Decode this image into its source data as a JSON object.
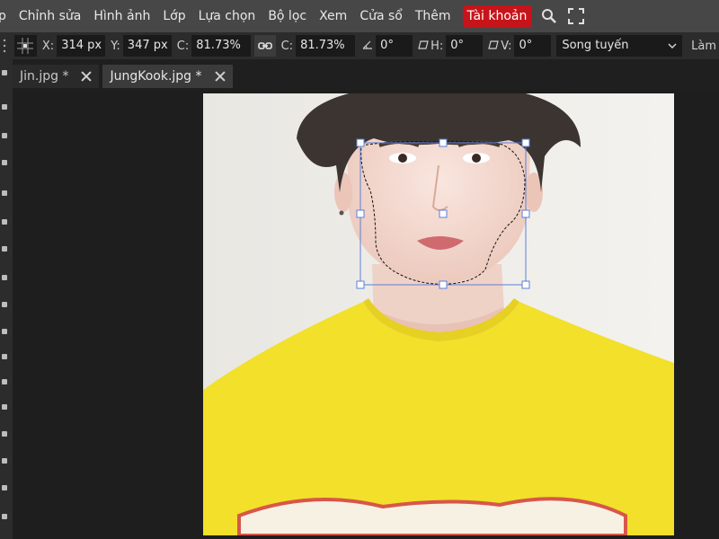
{
  "menu": {
    "items": [
      "p",
      "Chỉnh sửa",
      "Hình ảnh",
      "Lớp",
      "Lựa chọn",
      "Bộ lọc",
      "Xem",
      "Cửa sổ",
      "Thêm"
    ],
    "account_label": "Tài khoản",
    "icons": [
      "search-icon",
      "fullscreen-icon"
    ]
  },
  "options": {
    "x_label": "X:",
    "x_value": "314 px",
    "y_label": "Y:",
    "y_value": "347 px",
    "w_label": "C:",
    "w_value": "81.73%",
    "h_label": "C:",
    "h_value": "81.73%",
    "rotate_value": "0°",
    "skew_h_label": "H:",
    "skew_h_value": "0°",
    "skew_v_label": "V:",
    "skew_v_value": "0°",
    "interpolation": "Song tuyến",
    "overflow_label": "Làm"
  },
  "tabs": [
    {
      "label": "Jin.jpg *",
      "active": false
    },
    {
      "label": "JungKook.jpg *",
      "active": true
    }
  ],
  "colors": {
    "accent": "#c7141a",
    "shirt": "#f2e02a",
    "selection": "#5b7fd8"
  }
}
